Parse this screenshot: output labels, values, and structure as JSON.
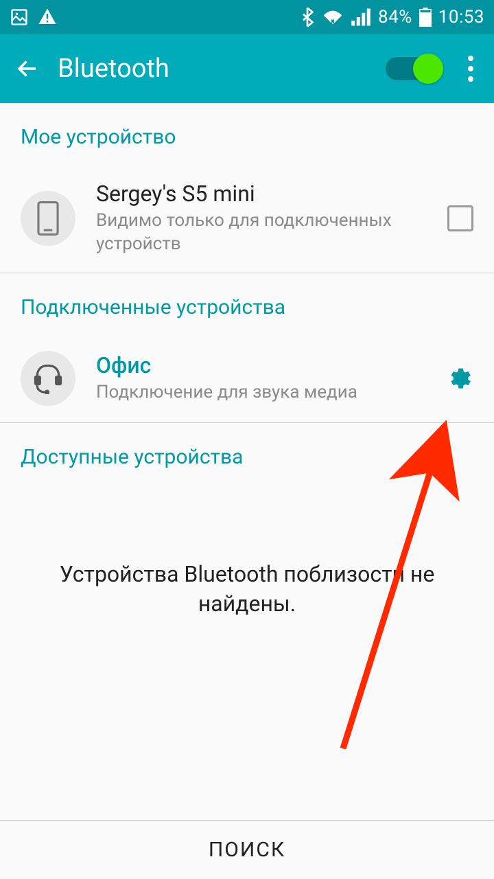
{
  "status": {
    "battery_pct": "84%",
    "time": "10:53"
  },
  "header": {
    "title": "Bluetooth"
  },
  "sections": {
    "my_device": "Мое устройство",
    "connected": "Подключенные устройства",
    "available": "Доступные устройства"
  },
  "my_device": {
    "name": "Sergey's S5 mini",
    "sub": "Видимо только для подключенных устройств"
  },
  "connected_device": {
    "name": "Офис",
    "sub": "Подключение для звука медиа"
  },
  "empty": "Устройства Bluetooth поблизости не найдены.",
  "footer": {
    "search": "ПОИСК"
  }
}
